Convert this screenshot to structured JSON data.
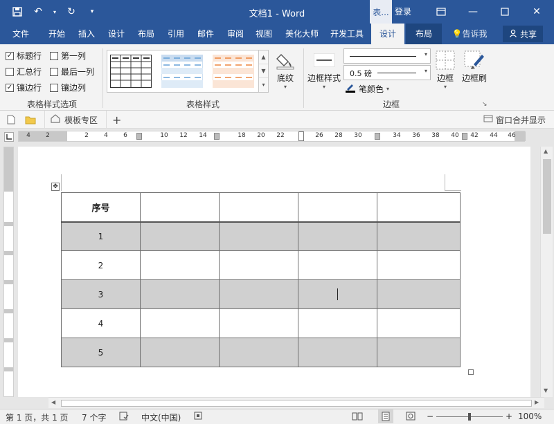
{
  "titlebar": {
    "doc_title": "文档1 - Word",
    "context_tab": "表...",
    "login": "登录"
  },
  "tabs": [
    {
      "label": "文件"
    },
    {
      "label": "开始"
    },
    {
      "label": "插入"
    },
    {
      "label": "设计"
    },
    {
      "label": "布局"
    },
    {
      "label": "引用"
    },
    {
      "label": "邮件"
    },
    {
      "label": "审阅"
    },
    {
      "label": "视图"
    },
    {
      "label": "美化大师"
    },
    {
      "label": "开发工具"
    },
    {
      "label": "设计"
    },
    {
      "label": "布局"
    },
    {
      "label": "告诉我"
    }
  ],
  "share_label": "共享",
  "ribbon": {
    "options": [
      {
        "label": "标题行",
        "checked": true
      },
      {
        "label": "第一列",
        "checked": false
      },
      {
        "label": "汇总行",
        "checked": false
      },
      {
        "label": "最后一列",
        "checked": false
      },
      {
        "label": "镶边行",
        "checked": true
      },
      {
        "label": "镶边列",
        "checked": false
      }
    ],
    "group_options_label": "表格样式选项",
    "group_styles_label": "表格样式",
    "shading_label": "底纹",
    "border_styles_label": "边框样式",
    "pen_weight": "0.5 磅",
    "pen_color_label": "笔颜色",
    "borders_label": "边框",
    "border_painter_label": "边框刷",
    "group_borders_label": "边框"
  },
  "docbar": {
    "template_label": "模板专区",
    "merge_label": "窗口合并显示"
  },
  "ruler_ticks": [
    "4",
    "2",
    "2",
    "4",
    "6",
    "10",
    "12",
    "14",
    "18",
    "20",
    "22",
    "26",
    "28",
    "30",
    "34",
    "36",
    "38",
    "40",
    "42",
    "44",
    "46"
  ],
  "table": {
    "header": "序号",
    "rows": [
      "1",
      "2",
      "3",
      "4",
      "5"
    ]
  },
  "status": {
    "page": "第 1 页，共 1 页",
    "words": "7 个字",
    "language": "中文(中国)",
    "zoom": "100%"
  },
  "colors": {
    "accent": "#2b579a",
    "ribbon_bg": "#f3f3f3",
    "shaded_row": "#d0d0d0"
  }
}
